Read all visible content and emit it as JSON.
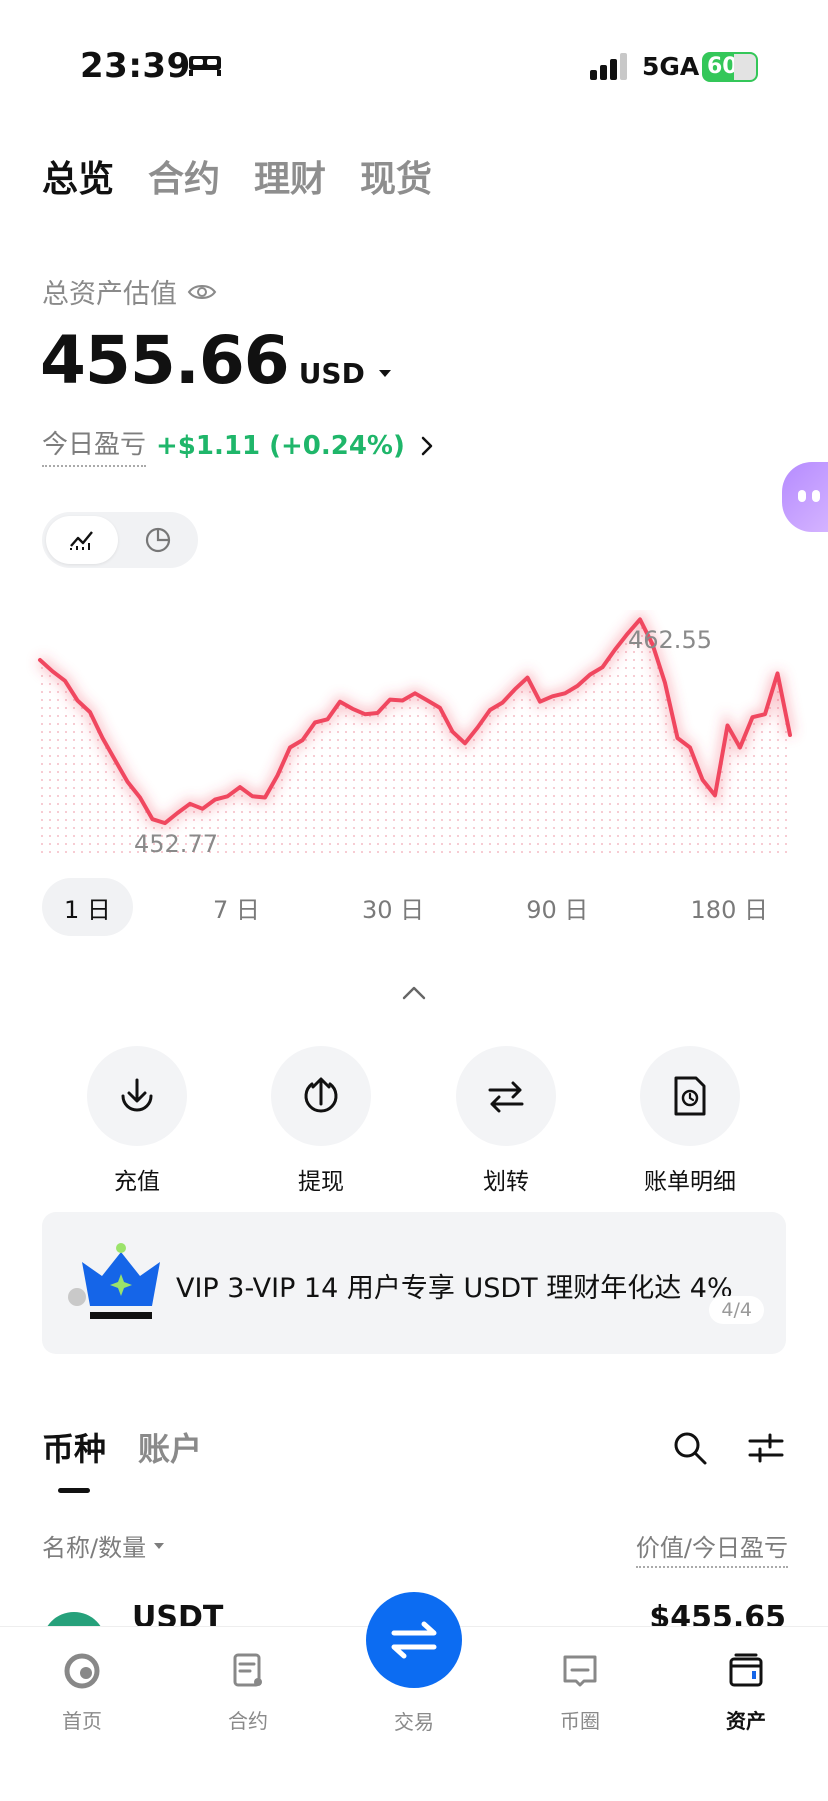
{
  "status_bar": {
    "time": "23:39",
    "network": "5GA",
    "battery": "60"
  },
  "top_tabs": [
    {
      "label": "总览",
      "active": true
    },
    {
      "label": "合约",
      "active": false
    },
    {
      "label": "理财",
      "active": false
    },
    {
      "label": "现货",
      "active": false
    }
  ],
  "assets": {
    "title": "总资产估值",
    "value": "455.66",
    "currency": "USD",
    "pnl_label": "今日盈亏",
    "pnl_value": "+$1.11 (+0.24%)"
  },
  "chart": {
    "high_label": "462.55",
    "low_label": "452.77",
    "line_color": "#f0475f"
  },
  "chart_data": {
    "type": "line",
    "title": "",
    "xlabel": "",
    "ylabel": "",
    "x": [
      0,
      1,
      2,
      3,
      4,
      5,
      6,
      7,
      8,
      9,
      10,
      11,
      12,
      13,
      14,
      15,
      16,
      17,
      18,
      19,
      20,
      21,
      22,
      23,
      24,
      25,
      26,
      27,
      28,
      29,
      30,
      31,
      32,
      33,
      34,
      35,
      36,
      37,
      38,
      39,
      40,
      41,
      42,
      43,
      44,
      45,
      46,
      47,
      48,
      49,
      50,
      51,
      52,
      53,
      54,
      55,
      56,
      57,
      58,
      59,
      60
    ],
    "values": [
      460.6,
      460.2,
      459.6,
      458.8,
      458.1,
      457.0,
      455.8,
      454.9,
      454.0,
      453.1,
      452.77,
      453.4,
      453.7,
      453.6,
      453.9,
      454.2,
      454.5,
      454.2,
      454.0,
      455.2,
      456.4,
      456.9,
      457.6,
      457.9,
      458.6,
      458.4,
      458.0,
      458.2,
      458.7,
      458.8,
      459.0,
      458.8,
      458.3,
      457.3,
      456.6,
      457.5,
      458.2,
      458.7,
      459.2,
      459.9,
      458.6,
      459.0,
      459.0,
      459.5,
      459.9,
      460.4,
      461.1,
      462.0,
      462.55,
      461.5,
      459.5,
      457.0,
      456.4,
      455.0,
      454.1,
      457.6,
      456.4,
      458.0,
      458.0,
      460.1,
      457.0
    ],
    "ylim": [
      451,
      463
    ],
    "grid": false
  },
  "range_tabs": [
    {
      "label": "1 日",
      "active": true
    },
    {
      "label": "7 日",
      "active": false
    },
    {
      "label": "30 日",
      "active": false
    },
    {
      "label": "90 日",
      "active": false
    },
    {
      "label": "180 日",
      "active": false
    }
  ],
  "actions": [
    {
      "label": "充值"
    },
    {
      "label": "提现"
    },
    {
      "label": "划转"
    },
    {
      "label": "账单明细"
    }
  ],
  "banner": {
    "text": "VIP 3-VIP 14 用户专享 USDT 理财年化达 4%",
    "pager": "4/4"
  },
  "list_tabs": [
    {
      "label": "币种",
      "active": true
    },
    {
      "label": "账户",
      "active": false
    }
  ],
  "list_header": {
    "left": "名称/数量",
    "right": "价值/今日盈亏"
  },
  "coin_row": {
    "name": "USDT",
    "value": "$455.65"
  },
  "bottom_nav": [
    {
      "label": "首页"
    },
    {
      "label": "合约"
    },
    {
      "label": "交易"
    },
    {
      "label": "币圈"
    },
    {
      "label": "资产"
    }
  ]
}
